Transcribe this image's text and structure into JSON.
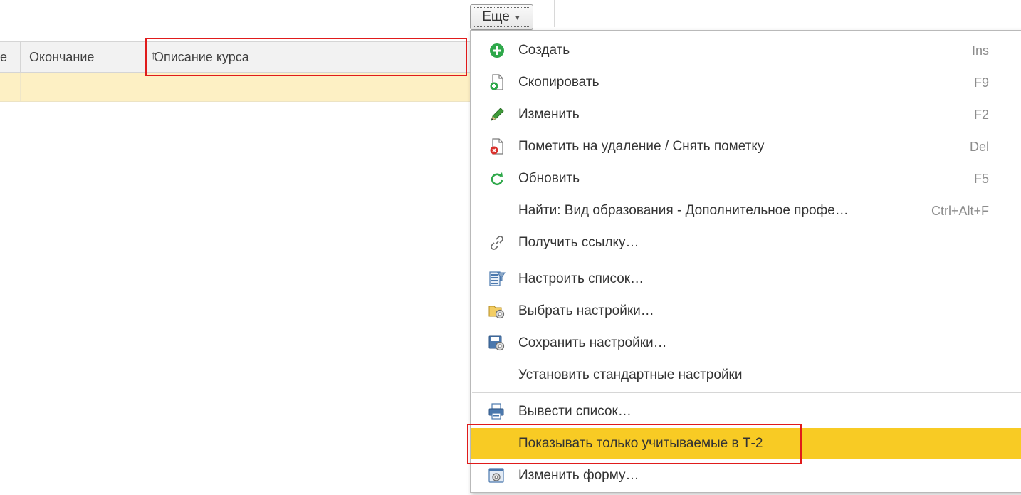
{
  "toolbar": {
    "more_label": "Еще"
  },
  "grid": {
    "columns": [
      {
        "label": "е"
      },
      {
        "label": "Окончание",
        "sort": "↑"
      },
      {
        "label": "Описание курса"
      }
    ]
  },
  "menu": {
    "items": [
      {
        "label": "Создать",
        "shortcut": "Ins",
        "icon": "create-icon"
      },
      {
        "label": "Скопировать",
        "shortcut": "F9",
        "icon": "copy-icon"
      },
      {
        "label": "Изменить",
        "shortcut": "F2",
        "icon": "edit-icon"
      },
      {
        "label": "Пометить на удаление / Снять пометку",
        "shortcut": "Del",
        "icon": "mark-delete-icon"
      },
      {
        "label": "Обновить",
        "shortcut": "F5",
        "icon": "refresh-icon"
      },
      {
        "label": "Найти: Вид образования - Дополнительное профе…",
        "shortcut": "Ctrl+Alt+F",
        "icon": ""
      },
      {
        "label": "Получить ссылку…",
        "shortcut": "",
        "icon": "link-icon"
      },
      {
        "label": "Настроить список…",
        "shortcut": "",
        "icon": "list-settings-icon"
      },
      {
        "label": "Выбрать настройки…",
        "shortcut": "",
        "icon": "choose-settings-icon"
      },
      {
        "label": "Сохранить настройки…",
        "shortcut": "",
        "icon": "save-settings-icon"
      },
      {
        "label": "Установить стандартные настройки",
        "shortcut": "",
        "icon": ""
      },
      {
        "label": "Вывести список…",
        "shortcut": "",
        "icon": "print-list-icon"
      },
      {
        "label": "Показывать только учитываемые в Т-2",
        "shortcut": "",
        "icon": "",
        "active": true
      },
      {
        "label": "Изменить форму…",
        "shortcut": "",
        "icon": "change-form-icon"
      }
    ]
  },
  "colors": {
    "highlight": "#e01b1b",
    "active_item": "#f8cb24",
    "selected_row": "#fdf0c4"
  }
}
